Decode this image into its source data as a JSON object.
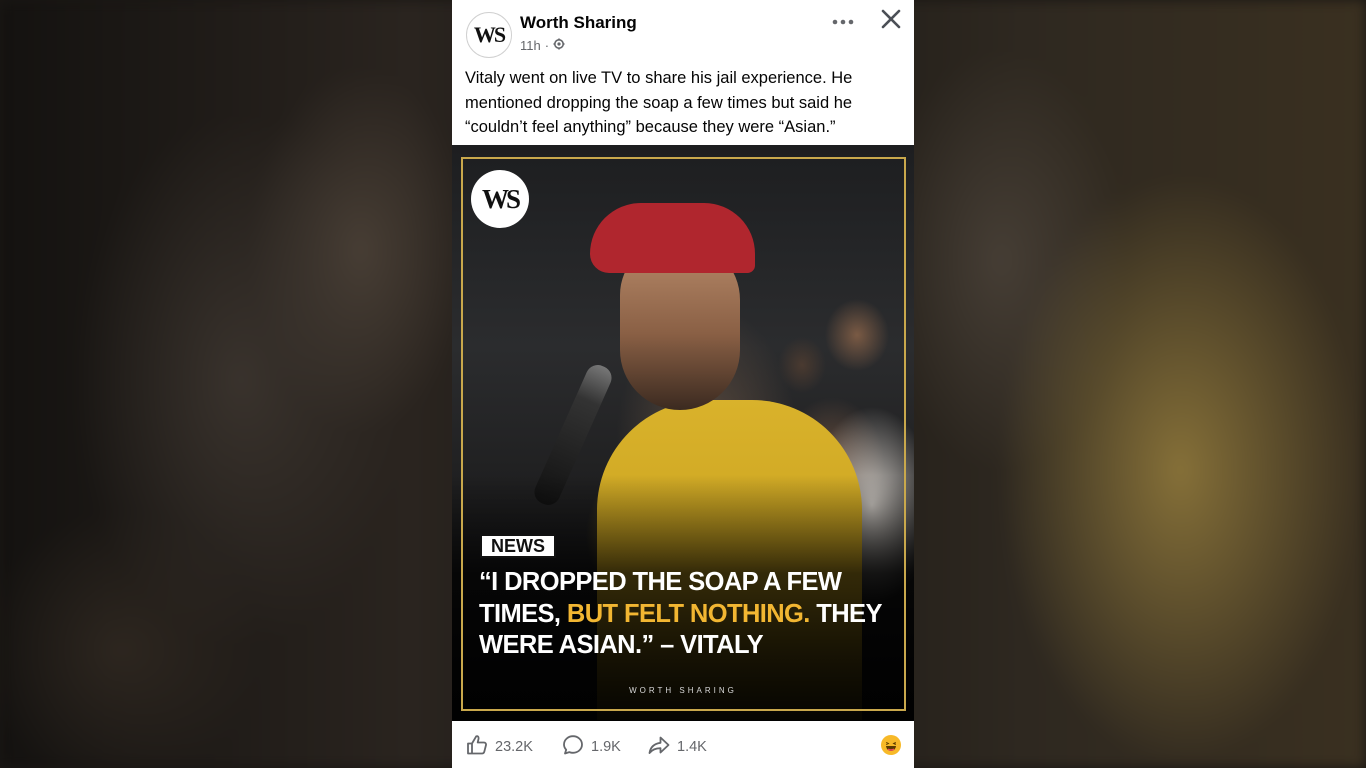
{
  "post": {
    "page_name": "Worth Sharing",
    "avatar_initials": "WS",
    "time": "11h",
    "meta_separator": "·",
    "privacy_icon": "globe-settings-icon",
    "caption": "Vitaly went on live TV to share his jail experience. He mentioned dropping the soap a few times but said he “couldn’t feel anything” because they were “Asian.”"
  },
  "media": {
    "logo_initials": "WS",
    "badge": "NEWS",
    "headline_part1": "“I DROPPED THE SOAP A FEW TIMES, ",
    "headline_highlight": "BUT FELT NOTHING.",
    "headline_part2": " THEY WERE ASIAN.” – VITALY",
    "watermark": "WORTH SHARING",
    "frame_color": "#c9a84c",
    "highlight_color": "#f2b632"
  },
  "footer": {
    "likes": "23.2K",
    "comments": "1.9K",
    "shares": "1.4K",
    "reaction_icon": "laughing-emoji-icon"
  }
}
